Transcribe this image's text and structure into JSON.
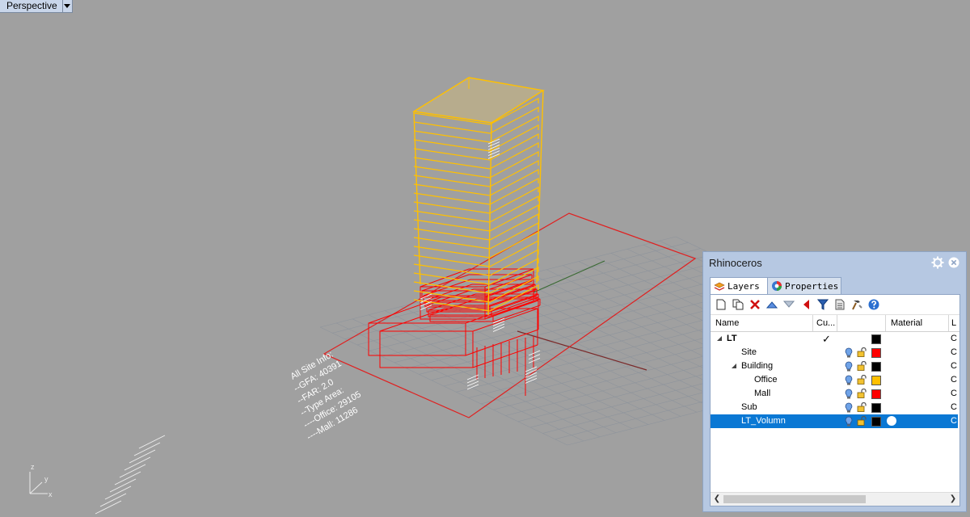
{
  "viewport": {
    "label": "Perspective",
    "axis_labels": {
      "z": "z",
      "y": "y",
      "x": "x"
    },
    "annotation_main": [
      "All Site Info:",
      "--GFA: 40391",
      "--FAR: 2.0",
      "--Type Area:",
      "----Office: 29105",
      "----Mall: 11286"
    ]
  },
  "panel": {
    "title": "Rhinoceros",
    "tabs": [
      {
        "label": "Layers",
        "icon": "layers-icon"
      },
      {
        "label": "Properties",
        "icon": "properties-icon"
      }
    ],
    "toolbar": [
      "new-layer-icon",
      "new-sublayer-icon",
      "delete-icon",
      "move-up-icon",
      "move-down-icon",
      "move-to-parent-icon",
      "filter-icon",
      "tools-icon",
      "hammer-icon",
      "help-icon"
    ],
    "columns": {
      "name": "Name",
      "current": "Cu...",
      "material": "Material",
      "tail": "L"
    },
    "layers": [
      {
        "name": "LT",
        "level": 0,
        "expanded": true,
        "current": "✓",
        "color": "#000000",
        "tail": "C"
      },
      {
        "name": "Site",
        "level": 1,
        "color": "#ff0000",
        "tail": "C"
      },
      {
        "name": "Building",
        "level": 1,
        "expanded": true,
        "color": "#000000",
        "tail": "C"
      },
      {
        "name": "Office",
        "level": 2,
        "color": "#ffc000",
        "tail": "C"
      },
      {
        "name": "Mall",
        "level": 2,
        "color": "#ff0000",
        "tail": "C"
      },
      {
        "name": "Sub",
        "level": 1,
        "color": "#000000",
        "tail": "C"
      },
      {
        "name": "LT_Volumn",
        "level": 1,
        "color": "#000000",
        "selected": true,
        "tail": "C"
      }
    ]
  },
  "colors": {
    "tower": "#ffc000",
    "podium": "#ff0000",
    "site": "#e02020",
    "grid": "#8e949c"
  }
}
